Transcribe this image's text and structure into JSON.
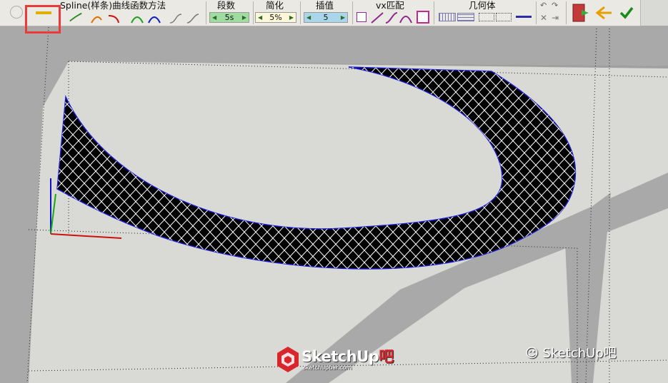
{
  "toolbar": {
    "spline_title": "Spline(样条)曲线函数方法",
    "segments_label": "段数",
    "segments_value": "5s",
    "simplify_label": "简化",
    "simplify_value": "5%",
    "interp_label": "插值",
    "interp_value": "5",
    "vx_label": "vx匹配",
    "geom_label": "几何体"
  },
  "watermark": {
    "brand_main": "SketchUp",
    "brand_suffix": "吧",
    "brand_url": "sketchupbar.com",
    "wechat_text": "SketchUp吧"
  },
  "colors": {
    "highlight": "#ea3a3a",
    "curve_outline": "#1a1acc",
    "mesh_fill": "#000000",
    "mesh_lines": "#ffffff",
    "ground": "#d9d9d6",
    "wall": "#a8a9a8",
    "axis_red": "#cc1111",
    "axis_green": "#11aa11",
    "axis_blue": "#1111cc"
  }
}
